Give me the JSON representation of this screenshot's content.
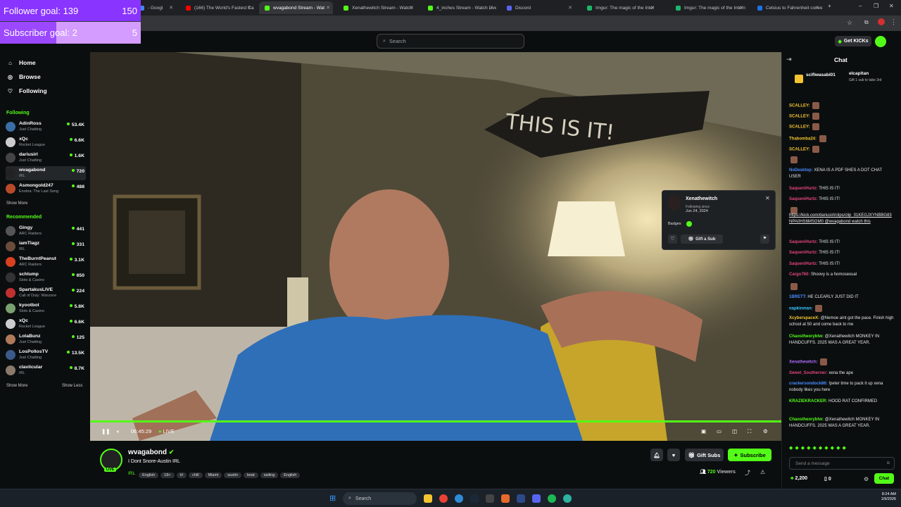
{
  "overlay": {
    "follower_label": "Follower goal:",
    "follower_current": "139",
    "follower_target": "150",
    "follower_progress": 0.927,
    "subscriber_label": "Subscriber goal:",
    "subscriber_current": "2",
    "subscriber_target": "5",
    "subscriber_progress": 0.4
  },
  "browser": {
    "tabs": [
      {
        "label": "- Googl"
      },
      {
        "label": "(166) The World's Fastest Car"
      },
      {
        "label": "wvagabond Stream - Wat"
      },
      {
        "label": "Xenathewitch Stream - Watch"
      },
      {
        "label": "4_inches Stream - Watch Live"
      },
      {
        "label": "Discord"
      },
      {
        "label": "Imgur: The magic of the Inter"
      },
      {
        "label": "Imgur: The magic of the Intern"
      },
      {
        "label": "Celsius to Fahrenheit convers"
      }
    ],
    "new_tab": "+",
    "min": "–",
    "max": "❐",
    "close": "✕"
  },
  "header": {
    "search_placeholder": "Search",
    "get_kicks": "Get KICKs"
  },
  "sidebar": {
    "nav": [
      {
        "label": "Home"
      },
      {
        "label": "Browse"
      },
      {
        "label": "Following"
      }
    ],
    "following_title": "Following",
    "following": [
      {
        "name": "AdinRoss",
        "category": "Just Chatting",
        "viewers": "53.4K",
        "color": "#3a6ea5"
      },
      {
        "name": "xQc",
        "category": "Rocket League",
        "viewers": "6.6K",
        "color": "#cccccc"
      },
      {
        "name": "dariusirl",
        "category": "Just Chatting",
        "viewers": "1.6K",
        "color": "#444444"
      },
      {
        "name": "wvagabond",
        "category": "IRL",
        "viewers": "720",
        "color": "#222222"
      },
      {
        "name": "Asmongold247",
        "category": "Enotria: The Last Song",
        "viewers": "488",
        "color": "#b84a2a"
      }
    ],
    "show_more_1": "Show More",
    "recommended_title": "Recommended",
    "recommended": [
      {
        "name": "Gingy",
        "category": "ARC Raiders",
        "viewers": "441",
        "color": "#555555"
      },
      {
        "name": "iamTlagz",
        "category": "IRL",
        "viewers": "331",
        "color": "#6b4b3a"
      },
      {
        "name": "TheBurntPeanut",
        "category": "ARC Raiders",
        "viewers": "3.1K",
        "color": "#d94020"
      },
      {
        "name": "schlump",
        "category": "Slots & Casino",
        "viewers": "650",
        "color": "#333333"
      },
      {
        "name": "SpartakusLIVE",
        "category": "Call of Duty: Warzone",
        "viewers": "224",
        "color": "#c03030"
      },
      {
        "name": "kyootbot",
        "category": "Slots & Casino",
        "viewers": "5.8K",
        "color": "#7aa070"
      },
      {
        "name": "xQc",
        "category": "Rocket League",
        "viewers": "6.6K",
        "color": "#cccccc"
      },
      {
        "name": "LolaBunz",
        "category": "Just Chatting",
        "viewers": "125",
        "color": "#b07a5a"
      },
      {
        "name": "LosPollosTV",
        "category": "Just Chatting",
        "viewers": "13.5K",
        "color": "#3a5a8a"
      },
      {
        "name": "claviicular",
        "category": "IRL",
        "viewers": "8.7K",
        "color": "#8a7a6a"
      }
    ],
    "show_more_2": "Show More",
    "show_less": "Show Less"
  },
  "player": {
    "time": "06:45:29",
    "live": "LIVE",
    "video_sign_text": "THIS IS IT!"
  },
  "usercard": {
    "name": "Xenathewitch",
    "following_since_label": "Following since",
    "following_since": "Jun 24, 2024",
    "badges_label": "Badges",
    "gift_label": "Gift a Sub"
  },
  "stream": {
    "channel": "wvagabond",
    "title": "I Dont Snore-Austin IRL",
    "category": "IRL",
    "tags": [
      "English",
      "18+",
      "Irl",
      "chill",
      "Miami",
      "austin",
      "boat",
      "sailing",
      "English"
    ],
    "live_badge": "LIVE",
    "gift_subs": "Gift Subs",
    "subscribe": "Subscribe",
    "viewers": "720",
    "viewers_label": "Viewers"
  },
  "chat": {
    "title": "Chat",
    "pinned_user1": "scifiwasabi01",
    "pinned_user2": "elcapitan",
    "pinned_note": "Gift 1 sub to take 3rd",
    "messages": [
      {
        "user": "SCALLEY:",
        "text": "",
        "color": "#f4c430"
      },
      {
        "user": "SCALLEY:",
        "text": "",
        "color": "#f4c430"
      },
      {
        "user": "SCALLEY:",
        "text": "",
        "color": "#f4c430"
      },
      {
        "user": "Thabomba24:",
        "text": "",
        "color": "#f4c430"
      },
      {
        "user": "SCALLEY:",
        "text": "",
        "color": "#f4c430"
      },
      {
        "user": "",
        "text": "",
        "color": "#e0457b"
      },
      {
        "user": "NoDesktop:",
        "text": "XENA IS A PDF SHES A DOT CHAT USER",
        "color": "#4a8cff"
      },
      {
        "user": "SaqueniHurtz:",
        "text": "THIS IS IT!",
        "color": "#e0457b"
      },
      {
        "user": "SaqueniHurtz:",
        "text": "THIS IS IT!",
        "color": "#e0457b"
      },
      {
        "user": "",
        "text": "",
        "color": "#e0457b"
      },
      {
        "user": "",
        "text": "https://kick.com/dariusirl/clips/clip_01KEGJXYNBBG83NPA0HS6MSGM0 @wvagabond watch this",
        "color": "#ffffff"
      },
      {
        "user": "SaqueniHurtz:",
        "text": "THIS IS IT!",
        "color": "#e0457b"
      },
      {
        "user": "SaqueniHurtz:",
        "text": "THIS IS IT!",
        "color": "#e0457b"
      },
      {
        "user": "SaqueniHurtz:",
        "text": "THIS IS IT!",
        "color": "#e0457b"
      },
      {
        "user": "Cargo760:",
        "text": "Shoovy is a homosexual",
        "color": "#e0457b"
      },
      {
        "user": "",
        "text": "",
        "color": "#e0457b"
      },
      {
        "user": "1BRETT:",
        "text": "HE CLEARLY JUST DID IT",
        "color": "#4a8cff"
      },
      {
        "user": "napkinman:",
        "text": "",
        "color": "#37c8ff"
      },
      {
        "user": "XcyberspaceX:",
        "text": "@Nemoe aint got the pace. Finish high school at 50 and come back to me",
        "color": "#f4c430"
      },
      {
        "user": "Chaostheorybtw:",
        "text": "@Xenathewitch MONKEY IN HANDCUFFS. 2025 WAS A GREAT YEAR.",
        "color": "#53fc18"
      },
      {
        "user": "Xenathewitch:",
        "text": "",
        "color": "#b06bff"
      },
      {
        "user": "Sweet_Southerner:",
        "text": "xena the ape",
        "color": "#e0457b"
      },
      {
        "user": "crackersondock86:",
        "text": "!peter time to pack it up xena nobody likes you here",
        "color": "#4a8cff"
      },
      {
        "user": "KRAZIEKRACKER:",
        "text": "HOOD RAT CONFIRMED",
        "color": "#53fc18"
      },
      {
        "user": "Chaostheorybtw:",
        "text": "@Xenathewitch MONKEY IN HANDCUFFS. 2025 WAS A GREAT YEAR.",
        "color": "#53fc18"
      }
    ],
    "input_placeholder": "Send a message",
    "points": "2,200",
    "count2": "0",
    "send_label": "Chat"
  },
  "taskbar": {
    "search": "Search",
    "time": "8:24 AM",
    "date": "1/9/2026"
  }
}
